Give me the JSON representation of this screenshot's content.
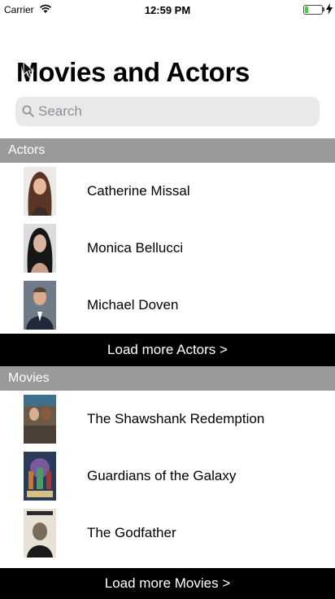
{
  "status_bar": {
    "carrier": "Carrier",
    "time": "12:59 PM",
    "battery_level": 0.2,
    "battery_color": "#3dd23d"
  },
  "header": {
    "title": "Movies and Actors"
  },
  "search": {
    "placeholder": "Search",
    "value": ""
  },
  "actors": {
    "header": "Actors",
    "items": [
      {
        "name": "Catherine Missal"
      },
      {
        "name": "Monica Bellucci"
      },
      {
        "name": "Michael Doven"
      }
    ],
    "load_more": "Load more Actors >"
  },
  "movies": {
    "header": "Movies",
    "items": [
      {
        "title": "The Shawshank Redemption"
      },
      {
        "title": "Guardians of the Galaxy"
      },
      {
        "title": "The Godfather"
      }
    ],
    "load_more": "Load more Movies >"
  },
  "colors": {
    "section_header_bg": "#9a9a9a",
    "load_more_bg": "#000000",
    "search_bg": "#e9e9eb"
  }
}
